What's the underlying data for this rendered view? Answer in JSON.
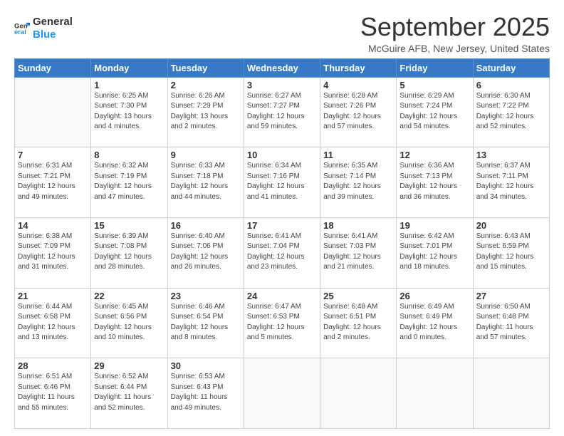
{
  "logo": {
    "line1": "General",
    "line2": "Blue"
  },
  "header": {
    "month": "September 2025",
    "location": "McGuire AFB, New Jersey, United States"
  },
  "weekdays": [
    "Sunday",
    "Monday",
    "Tuesday",
    "Wednesday",
    "Thursday",
    "Friday",
    "Saturday"
  ],
  "weeks": [
    [
      {
        "day": "",
        "info": ""
      },
      {
        "day": "1",
        "info": "Sunrise: 6:25 AM\nSunset: 7:30 PM\nDaylight: 13 hours\nand 4 minutes."
      },
      {
        "day": "2",
        "info": "Sunrise: 6:26 AM\nSunset: 7:29 PM\nDaylight: 13 hours\nand 2 minutes."
      },
      {
        "day": "3",
        "info": "Sunrise: 6:27 AM\nSunset: 7:27 PM\nDaylight: 12 hours\nand 59 minutes."
      },
      {
        "day": "4",
        "info": "Sunrise: 6:28 AM\nSunset: 7:26 PM\nDaylight: 12 hours\nand 57 minutes."
      },
      {
        "day": "5",
        "info": "Sunrise: 6:29 AM\nSunset: 7:24 PM\nDaylight: 12 hours\nand 54 minutes."
      },
      {
        "day": "6",
        "info": "Sunrise: 6:30 AM\nSunset: 7:22 PM\nDaylight: 12 hours\nand 52 minutes."
      }
    ],
    [
      {
        "day": "7",
        "info": "Sunrise: 6:31 AM\nSunset: 7:21 PM\nDaylight: 12 hours\nand 49 minutes."
      },
      {
        "day": "8",
        "info": "Sunrise: 6:32 AM\nSunset: 7:19 PM\nDaylight: 12 hours\nand 47 minutes."
      },
      {
        "day": "9",
        "info": "Sunrise: 6:33 AM\nSunset: 7:18 PM\nDaylight: 12 hours\nand 44 minutes."
      },
      {
        "day": "10",
        "info": "Sunrise: 6:34 AM\nSunset: 7:16 PM\nDaylight: 12 hours\nand 41 minutes."
      },
      {
        "day": "11",
        "info": "Sunrise: 6:35 AM\nSunset: 7:14 PM\nDaylight: 12 hours\nand 39 minutes."
      },
      {
        "day": "12",
        "info": "Sunrise: 6:36 AM\nSunset: 7:13 PM\nDaylight: 12 hours\nand 36 minutes."
      },
      {
        "day": "13",
        "info": "Sunrise: 6:37 AM\nSunset: 7:11 PM\nDaylight: 12 hours\nand 34 minutes."
      }
    ],
    [
      {
        "day": "14",
        "info": "Sunrise: 6:38 AM\nSunset: 7:09 PM\nDaylight: 12 hours\nand 31 minutes."
      },
      {
        "day": "15",
        "info": "Sunrise: 6:39 AM\nSunset: 7:08 PM\nDaylight: 12 hours\nand 28 minutes."
      },
      {
        "day": "16",
        "info": "Sunrise: 6:40 AM\nSunset: 7:06 PM\nDaylight: 12 hours\nand 26 minutes."
      },
      {
        "day": "17",
        "info": "Sunrise: 6:41 AM\nSunset: 7:04 PM\nDaylight: 12 hours\nand 23 minutes."
      },
      {
        "day": "18",
        "info": "Sunrise: 6:41 AM\nSunset: 7:03 PM\nDaylight: 12 hours\nand 21 minutes."
      },
      {
        "day": "19",
        "info": "Sunrise: 6:42 AM\nSunset: 7:01 PM\nDaylight: 12 hours\nand 18 minutes."
      },
      {
        "day": "20",
        "info": "Sunrise: 6:43 AM\nSunset: 6:59 PM\nDaylight: 12 hours\nand 15 minutes."
      }
    ],
    [
      {
        "day": "21",
        "info": "Sunrise: 6:44 AM\nSunset: 6:58 PM\nDaylight: 12 hours\nand 13 minutes."
      },
      {
        "day": "22",
        "info": "Sunrise: 6:45 AM\nSunset: 6:56 PM\nDaylight: 12 hours\nand 10 minutes."
      },
      {
        "day": "23",
        "info": "Sunrise: 6:46 AM\nSunset: 6:54 PM\nDaylight: 12 hours\nand 8 minutes."
      },
      {
        "day": "24",
        "info": "Sunrise: 6:47 AM\nSunset: 6:53 PM\nDaylight: 12 hours\nand 5 minutes."
      },
      {
        "day": "25",
        "info": "Sunrise: 6:48 AM\nSunset: 6:51 PM\nDaylight: 12 hours\nand 2 minutes."
      },
      {
        "day": "26",
        "info": "Sunrise: 6:49 AM\nSunset: 6:49 PM\nDaylight: 12 hours\nand 0 minutes."
      },
      {
        "day": "27",
        "info": "Sunrise: 6:50 AM\nSunset: 6:48 PM\nDaylight: 11 hours\nand 57 minutes."
      }
    ],
    [
      {
        "day": "28",
        "info": "Sunrise: 6:51 AM\nSunset: 6:46 PM\nDaylight: 11 hours\nand 55 minutes."
      },
      {
        "day": "29",
        "info": "Sunrise: 6:52 AM\nSunset: 6:44 PM\nDaylight: 11 hours\nand 52 minutes."
      },
      {
        "day": "30",
        "info": "Sunrise: 6:53 AM\nSunset: 6:43 PM\nDaylight: 11 hours\nand 49 minutes."
      },
      {
        "day": "",
        "info": ""
      },
      {
        "day": "",
        "info": ""
      },
      {
        "day": "",
        "info": ""
      },
      {
        "day": "",
        "info": ""
      }
    ]
  ]
}
